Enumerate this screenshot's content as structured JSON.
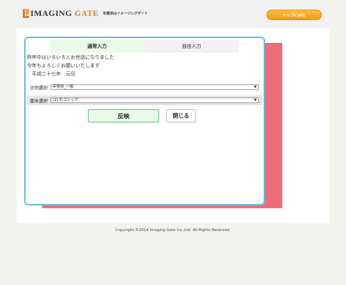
{
  "header": {
    "logo_text": "IMAGING",
    "logo_text_accent": "GATE",
    "logo_subtitle": "年賀状はイメージングゲート",
    "top_button": "トップに戻る"
  },
  "editor": {
    "tabs": [
      {
        "label": "通常入力",
        "active": true
      },
      {
        "label": "自由入力",
        "active": false
      }
    ],
    "message_lines": [
      "昨年中はいろいろとお世話になりました",
      "今年もよろしくお願いいたします",
      "　平成二十七年　元旦"
    ],
    "text_select": {
      "label": "文例選択",
      "value": "年賀状_一般"
    },
    "font_select": {
      "label": "書体選択",
      "value": "(2) 丸ゴシック"
    },
    "apply_button": "反映",
    "close_button": "閉じる"
  },
  "footer": {
    "copyright": "Copyright ©2014 Imaging Gate Co.,Ltd. All Rights Reserved."
  },
  "colors": {
    "accent_orange": "#f59a10",
    "panel_border": "#62bcd6",
    "shadow_pink": "#ef6c7a",
    "active_green": "#e8fbe8"
  }
}
